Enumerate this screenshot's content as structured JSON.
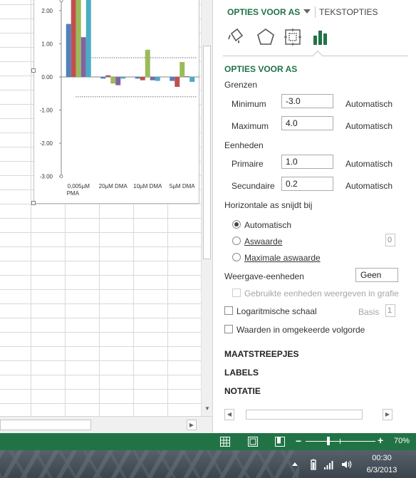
{
  "chart": {
    "y_ticks": [
      "2.00",
      "1.00",
      "0.00",
      "-1.00",
      "-2.00",
      "-3.00"
    ],
    "x_labels": [
      {
        "line1": "0,005µM",
        "line2": "PMA"
      },
      {
        "line1": "20µM DMA",
        "line2": ""
      },
      {
        "line1": "10µM DMA",
        "line2": ""
      },
      {
        "line1": "5µM DMA",
        "line2": ""
      }
    ]
  },
  "chart_data": {
    "type": "bar",
    "categories": [
      "0,005µM PMA",
      "20µM DMA",
      "10µM DMA",
      "5µM DMA"
    ],
    "series": [
      {
        "values": [
          1.6,
          -0.05,
          -0.05,
          -0.12
        ],
        "color": "#4f81bd"
      },
      {
        "values": [
          2.8,
          0.05,
          -0.1,
          -0.3
        ],
        "color": "#c0504d"
      },
      {
        "values": [
          2.8,
          -0.2,
          0.82,
          0.45
        ],
        "color": "#9bbb59"
      },
      {
        "values": [
          1.2,
          -0.25,
          -0.1,
          0.02
        ],
        "color": "#8064a2"
      },
      {
        "values": [
          2.8,
          -0.05,
          -0.12,
          -0.15
        ],
        "color": "#4bacc6"
      }
    ],
    "ylim": [
      -3.0,
      2.35
    ],
    "reference_lines": [
      0.58,
      -0.6
    ],
    "grid": false
  },
  "pane": {
    "tab_axis": "OPTIES VOOR AS",
    "tab_text": "TEKSTOPTIES",
    "section_title": "OPTIES VOOR AS",
    "grenzen": "Grenzen",
    "minimum_label": "Minimum",
    "minimum_value": "-3.0",
    "maximum_label": "Maximum",
    "maximum_value": "4.0",
    "eenheden": "Eenheden",
    "primaire_label": "Primaire",
    "primaire_value": "1.0",
    "secundaire_label": "Secundaire",
    "secundaire_value": "0.2",
    "auto_label": "Automatisch",
    "horizontal_cross": "Horizontale as snijdt bij",
    "radio_auto": "Automatisch",
    "radio_aswaarde": "Aswaarde",
    "aswaarde_value": "0",
    "radio_max": "Maximale aswaarde",
    "weergave_label": "Weergave-eenheden",
    "weergave_value": "Geen",
    "gebruikte_label": "Gebruikte eenheden weergeven in grafie",
    "log_label": "Logaritmische schaal",
    "basis_label": "Basis",
    "basis_value": "1",
    "reverse_label": "Waarden in omgekeerde volgorde",
    "maatstreepjes": "MAATSTREEPJES",
    "labels": "LABELS",
    "notatie": "NOTATIE"
  },
  "status": {
    "zoom": "70%"
  },
  "taskbar": {
    "time": "00:30",
    "date": "6/3/2013"
  },
  "colors": {
    "accent": "#217346",
    "status_bar": "#217346"
  },
  "icons": [
    "fill-line-icon",
    "effects-pentagon-icon",
    "size-properties-icon",
    "axis-options-bar-icon",
    "normal-view-icon",
    "page-layout-icon",
    "page-break-icon",
    "battery-icon",
    "signal-icon",
    "volume-icon",
    "show-hidden-icons-icon"
  ]
}
